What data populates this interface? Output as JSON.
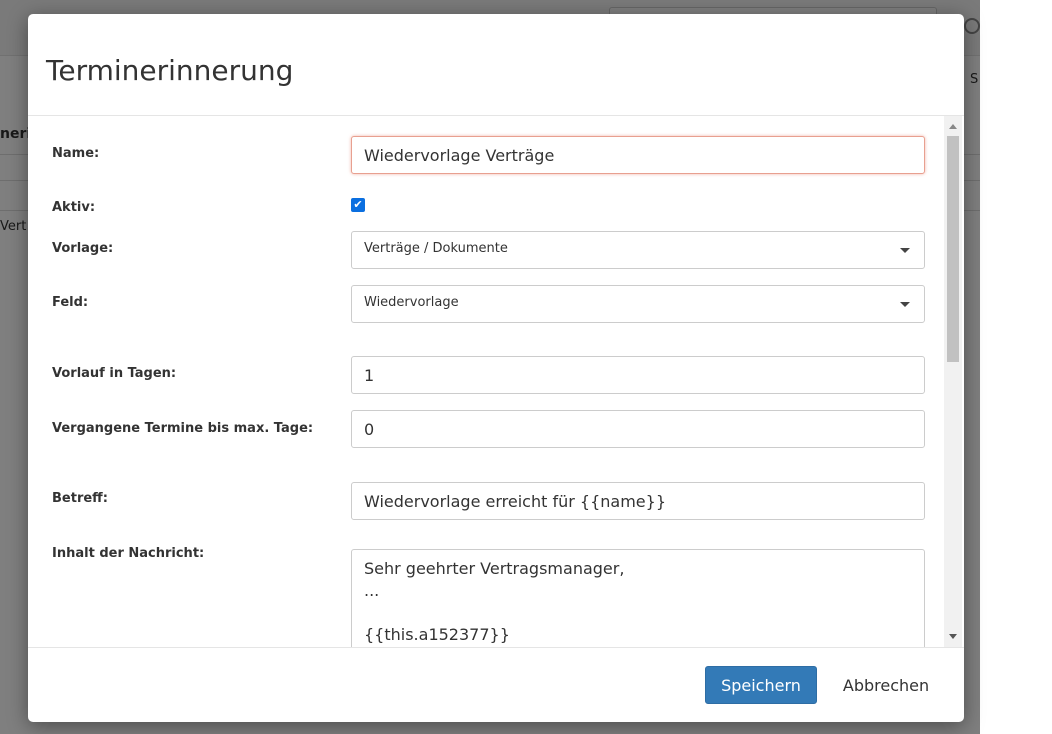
{
  "background": {
    "partial_text_top": "nerir",
    "partial_text_row": "Vert",
    "partial_text_right": "S"
  },
  "modal": {
    "title": "Terminerinnerung",
    "fields": {
      "name": {
        "label": "Name:",
        "value": "Wiedervorlage Verträge"
      },
      "aktiv": {
        "label": "Aktiv:",
        "checked": true
      },
      "vorlage": {
        "label": "Vorlage:",
        "value": "Verträge / Dokumente"
      },
      "feld": {
        "label": "Feld:",
        "value": "Wiedervorlage"
      },
      "vorlauf": {
        "label": "Vorlauf in Tagen:",
        "value": "1"
      },
      "vergangene": {
        "label": "Vergangene Termine bis max. Tage:",
        "value": "0"
      },
      "betreff": {
        "label": "Betreff:",
        "value": "Wiedervorlage erreicht für {{name}}"
      },
      "inhalt": {
        "label": "Inhalt der Nachricht:",
        "lines": [
          "Sehr geehrter Vertragsmanager,",
          "...",
          "",
          "{{this.a152377}}"
        ]
      }
    },
    "buttons": {
      "save": "Speichern",
      "cancel": "Abbrechen"
    }
  },
  "colors": {
    "primary": "#337ab7",
    "checkbox": "#0b6fe0",
    "focus_border": "#e8a090"
  }
}
